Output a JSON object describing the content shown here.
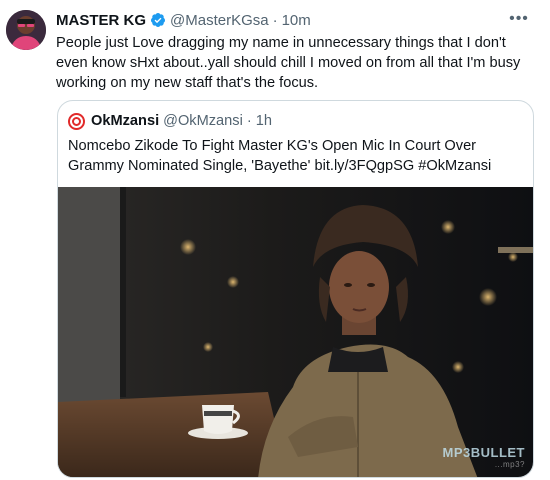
{
  "tweet": {
    "display_name": "MASTER KG",
    "handle": "@MasterKGsa",
    "separator": "·",
    "time": "10m",
    "more_label": "•••",
    "text": "People just Love dragging my name in unnecessary things that I don't even know sHxt about..yall should chill I moved on from all that I'm busy working on my new staff that's the focus."
  },
  "quote": {
    "display_name": "OkMzansi",
    "handle": "@OkMzansi",
    "separator": "·",
    "time": "1h",
    "text": "Nomcebo Zikode To Fight Master KG's Open Mic In Court Over Grammy Nominated Single, 'Bayethe' bit.ly/3FQgpSG #OkMzansi",
    "watermark": "MP3BULLET",
    "watermark_sub": "...mp3?"
  },
  "colors": {
    "verified": "#1d9bf0",
    "quote_avatar_ring": "#e12a2a",
    "secondary_text": "#536471",
    "border": "#cfd9de"
  },
  "icons": {
    "verified": "verified-badge-icon",
    "more": "more-options-icon"
  }
}
